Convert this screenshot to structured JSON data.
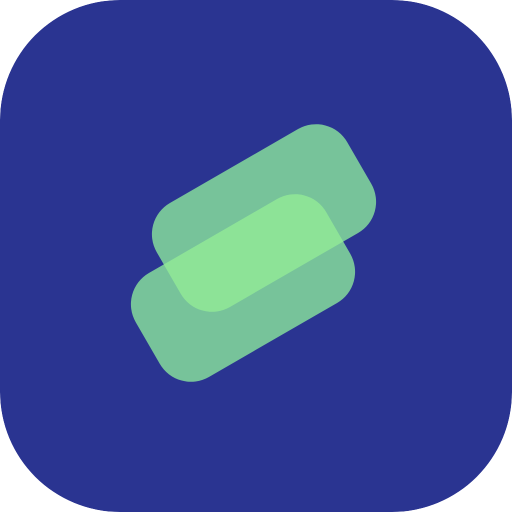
{
  "app_icon": {
    "icon": "stacked-cards-icon",
    "colors": {
      "background": "#2a3491",
      "card": "#7ecf9b",
      "card_overlap": "#8de397"
    }
  }
}
